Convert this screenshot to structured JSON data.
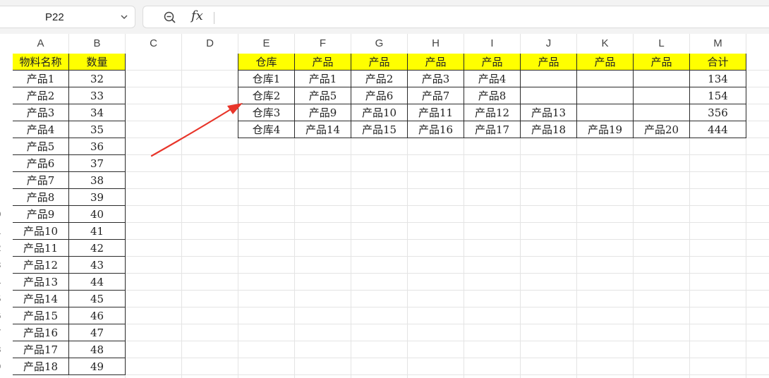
{
  "formula_bar": {
    "cell_reference": "P22",
    "fx_label": "fx",
    "formula": "",
    "icons": [
      "chevron-down-icon",
      "zoom-out-icon"
    ]
  },
  "columns": [
    "A",
    "B",
    "C",
    "D",
    "E",
    "F",
    "G",
    "H",
    "I",
    "J",
    "K",
    "L",
    "M"
  ],
  "row_numbers": [
    "",
    "",
    "",
    "",
    "",
    "",
    "",
    "",
    "",
    "0",
    "1",
    "2",
    "3",
    "4",
    "5",
    "6",
    "7",
    "8",
    "9"
  ],
  "left_table": {
    "headers": [
      "物料名称",
      "数量"
    ],
    "rows": [
      [
        "产品1",
        "32"
      ],
      [
        "产品2",
        "33"
      ],
      [
        "产品3",
        "34"
      ],
      [
        "产品4",
        "35"
      ],
      [
        "产品5",
        "36"
      ],
      [
        "产品6",
        "37"
      ],
      [
        "产品7",
        "38"
      ],
      [
        "产品8",
        "39"
      ],
      [
        "产品9",
        "40"
      ],
      [
        "产品10",
        "41"
      ],
      [
        "产品11",
        "42"
      ],
      [
        "产品12",
        "43"
      ],
      [
        "产品13",
        "44"
      ],
      [
        "产品14",
        "45"
      ],
      [
        "产品15",
        "46"
      ],
      [
        "产品16",
        "47"
      ],
      [
        "产品17",
        "48"
      ],
      [
        "产品18",
        "49"
      ]
    ]
  },
  "right_table": {
    "headers": [
      "仓库",
      "产品",
      "产品",
      "产品",
      "产品",
      "产品",
      "产品",
      "产品",
      "合计"
    ],
    "rows": [
      [
        "仓库1",
        "产品1",
        "产品2",
        "产品3",
        "产品4",
        "",
        "",
        "",
        "134"
      ],
      [
        "仓库2",
        "产品5",
        "产品6",
        "产品7",
        "产品8",
        "",
        "",
        "",
        "154"
      ],
      [
        "仓库3",
        "产品9",
        "产品10",
        "产品11",
        "产品12",
        "产品13",
        "",
        "",
        "356"
      ],
      [
        "仓库4",
        "产品14",
        "产品15",
        "产品16",
        "产品17",
        "产品18",
        "产品19",
        "产品20",
        "444"
      ]
    ]
  },
  "colors": {
    "header_fill": "#ffff00",
    "arrow": "#e8352a",
    "grid": "#e4e4e4",
    "border": "#2a2a2a"
  }
}
